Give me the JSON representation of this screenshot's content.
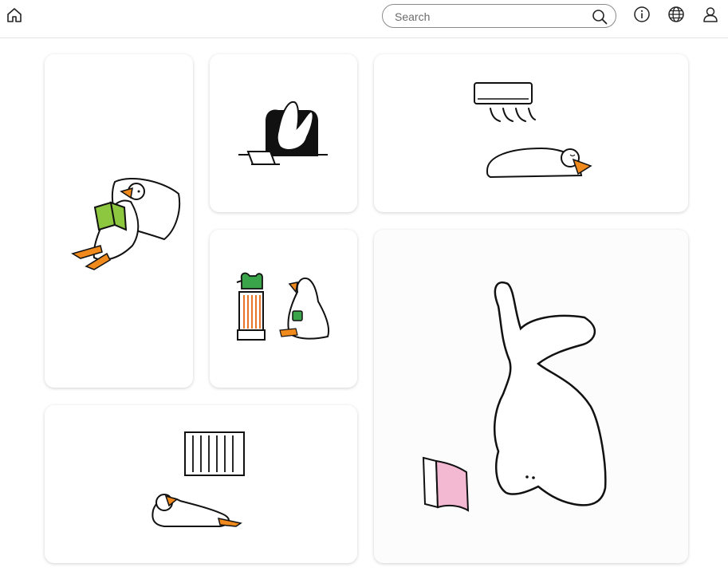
{
  "header": {
    "search": {
      "placeholder": "Search",
      "value": ""
    },
    "icons": [
      "home-icon",
      "search-icon",
      "info-icon",
      "globe-icon",
      "user-icon"
    ]
  },
  "gallery": {
    "cards": [
      {
        "id": "goose-reading-pillow",
        "icon": "goose-reading-illustration"
      },
      {
        "id": "goose-armchair-laptop",
        "icon": "goose-armchair-illustration"
      },
      {
        "id": "goose-air-conditioner",
        "icon": "goose-ac-illustration"
      },
      {
        "id": "goose-heater-tea",
        "icon": "goose-tea-illustration"
      },
      {
        "id": "goose-headstand-book",
        "icon": "goose-headstand-illustration"
      },
      {
        "id": "goose-radiator",
        "icon": "goose-radiator-illustration"
      }
    ]
  },
  "colors": {
    "orange": "#f08a1c",
    "green": "#8dc63f",
    "tea_green": "#3aa44a",
    "heater_orange": "#e8742a",
    "pink": "#f3b9d2"
  }
}
